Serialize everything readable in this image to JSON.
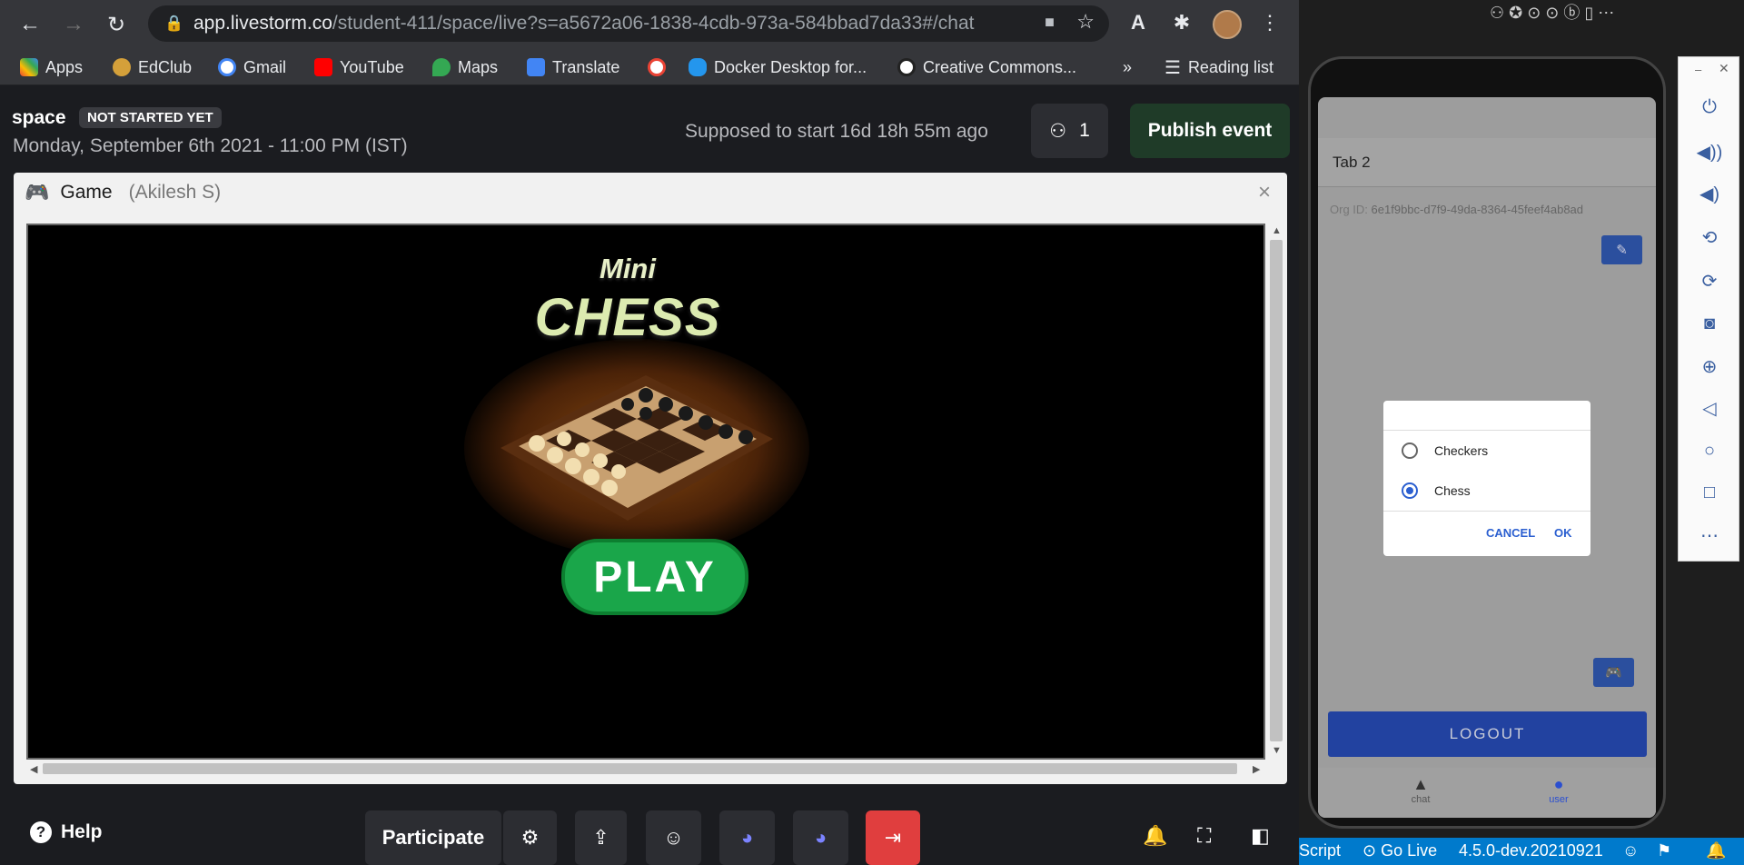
{
  "browser": {
    "url_domain": "app.livestorm.co",
    "url_path": "/student-411/space/live?s=a5672a06-1838-4cdb-973a-584bbad7da33#/chat",
    "bookmarks": [
      {
        "label": "Apps",
        "color": "#ea4335"
      },
      {
        "label": "EdClub",
        "color": "#d4a03a"
      },
      {
        "label": "Gmail",
        "color": "#ffffff"
      },
      {
        "label": "YouTube",
        "color": "#ff0000"
      },
      {
        "label": "Maps",
        "color": "#34a853"
      },
      {
        "label": "Translate",
        "color": "#4285f4"
      },
      {
        "label": "",
        "color": "#ffffff"
      },
      {
        "label": "Docker Desktop for...",
        "color": "#2496ed"
      },
      {
        "label": "Creative Commons...",
        "color": "#ffffff"
      }
    ],
    "more": "»",
    "reading_list": "Reading list"
  },
  "header": {
    "space_name": "space",
    "status_badge": "NOT STARTED YET",
    "date": "Monday, September 6th 2021 - 11:00 PM (IST)",
    "countdown": "Supposed to start 16d 18h 55m ago",
    "attendee_count": "1",
    "publish_label": "Publish event"
  },
  "game_panel": {
    "title": "Game",
    "owner": "(Akilesh S)",
    "close": "×",
    "game_mini": "Mini",
    "game_title": "CHESS",
    "play_label": "PLAY"
  },
  "footer": {
    "help_label": "Help",
    "participate_label": "Participate"
  },
  "phone": {
    "tab_title": "Tab 2",
    "org_label": "Org ID:",
    "org_id": "6e1f9bbc-d7f9-49da-8364-45feef4ab8ad",
    "dialog": {
      "options": [
        {
          "label": "Checkers",
          "selected": false
        },
        {
          "label": "Chess",
          "selected": true
        }
      ],
      "cancel": "CANCEL",
      "ok": "OK"
    },
    "logout_label": "LOGOUT",
    "tabs": [
      {
        "label": "chat"
      },
      {
        "label": "user"
      }
    ]
  },
  "vscode_status": {
    "script": "Script",
    "go_live": "Go Live",
    "version": "4.5.0-dev.20210921"
  }
}
